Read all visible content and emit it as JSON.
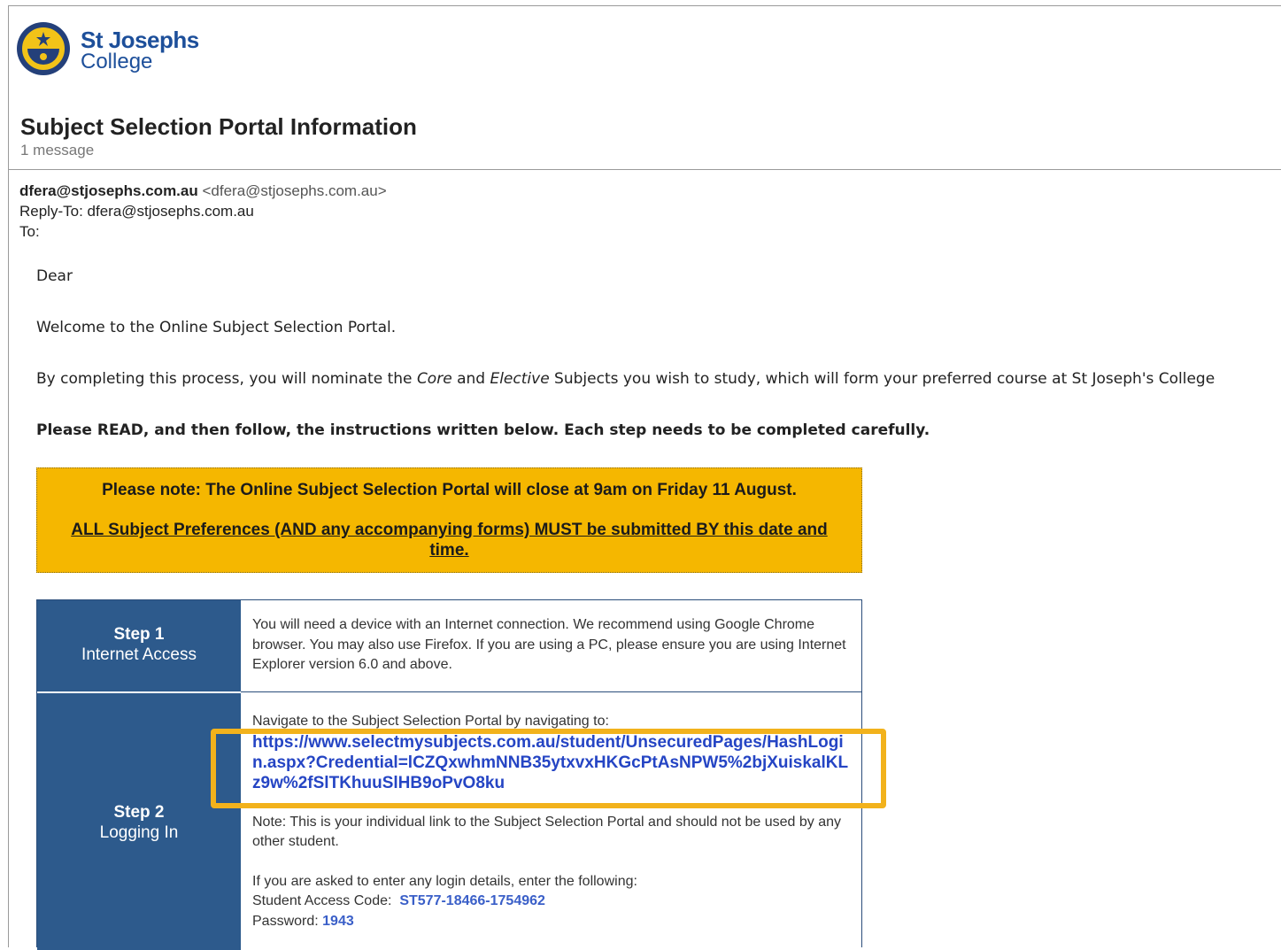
{
  "brand": {
    "name": "St Josephs",
    "sub": "College"
  },
  "email": {
    "subject": "Subject Selection Portal Information",
    "message_count": "1 message",
    "from_name": "dfera@stjosephs.com.au",
    "from_addr": "<dfera@stjosephs.com.au>",
    "reply_to": "Reply-To: dfera@stjosephs.com.au",
    "to": "To:"
  },
  "body": {
    "greeting": "Dear",
    "welcome": "Welcome to the Online Subject Selection Portal.",
    "intro_pre": "By completing this process, you will nominate the ",
    "intro_core": "Core",
    "intro_and": " and ",
    "intro_elective": "Elective",
    "intro_post": " Subjects you wish to study, which will form your preferred course at St Joseph's College",
    "instructions": "Please READ, and then follow, the instructions written below. Each step needs to be completed carefully."
  },
  "notice": {
    "line1": "Please note: The Online Subject Selection Portal will close at 9am on Friday 11 August.",
    "line2": "ALL Subject Preferences (AND any accompanying forms) MUST be submitted BY this date and time.",
    "bg_color": "#f5b700"
  },
  "steps": [
    {
      "num": "Step 1",
      "title": "Internet Access",
      "text": "You will need a device with an Internet connection. We recommend using Google Chrome browser. You may also use Firefox. If you are using a PC, please ensure you are using Internet Explorer version 6.0 and above."
    },
    {
      "num": "Step 2",
      "title": "Logging In",
      "navigate": "Navigate to the Subject Selection Portal by navigating to:",
      "link": "https://www.selectmysubjects.com.au/student/UnsecuredPages/HashLogin.aspx?Credential=lCZQxwhmNNB35ytxvxHKGcPtAsNPW5%2bjXuiskalKLz9w%2fSlTKhuuSlHB9oPvO8ku",
      "note": "Note: This is your individual link to the Subject Selection Portal and should not be used by any other student.",
      "login_intro": "If you are asked to enter any login details, enter the following:",
      "access_code_label": "Student Access Code:",
      "access_code": "ST577-18466-1754962",
      "password_label": "Password:",
      "password": "1943"
    }
  ],
  "colors": {
    "step_bg": "#2d5a8c",
    "highlight": "#f2b21c",
    "link": "#2545c4"
  }
}
